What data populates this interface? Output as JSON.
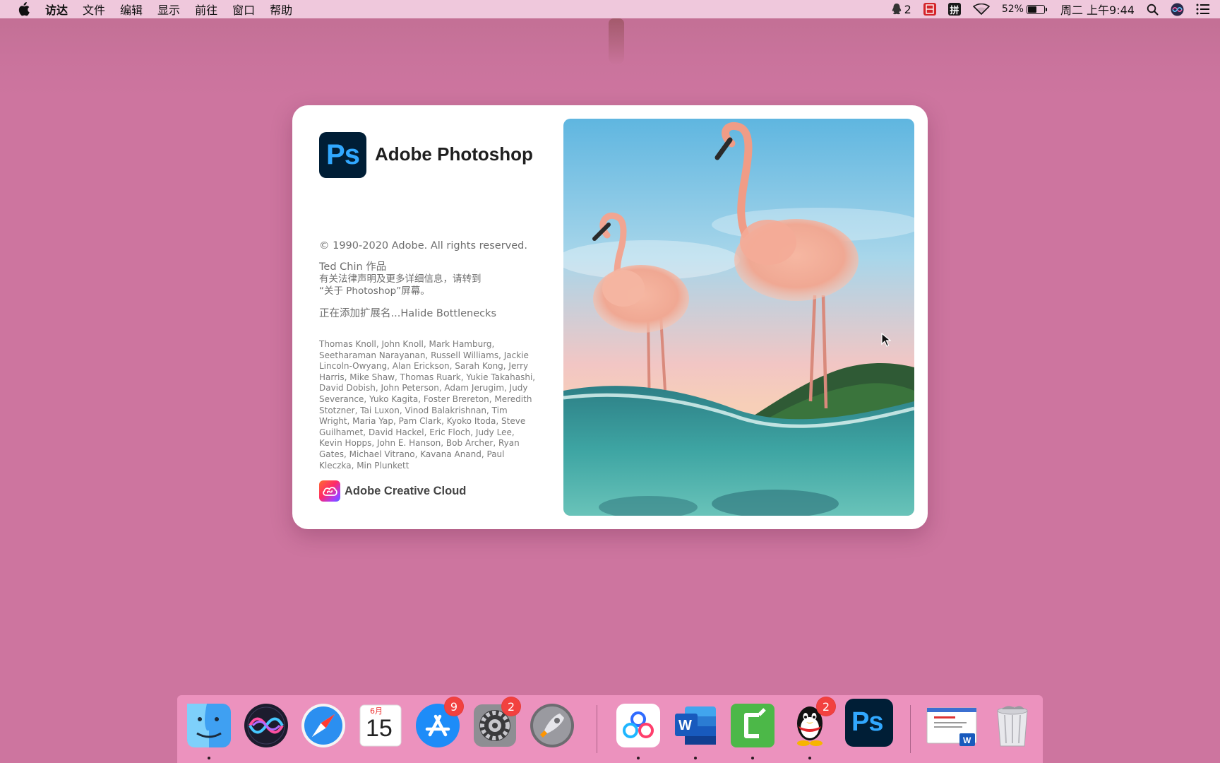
{
  "menubar": {
    "app_name": "访达",
    "items": [
      "文件",
      "编辑",
      "显示",
      "前往",
      "窗口",
      "帮助"
    ],
    "qq_count": "2",
    "input_method": "拼",
    "battery_percent": "52%",
    "battery_level": 0.52,
    "clock": "周二 上午9:44"
  },
  "splash": {
    "logo_text": "Ps",
    "app_name": "Adobe Photoshop",
    "copyright": "© 1990-2020 Adobe. All rights reserved.",
    "author": "Ted Chin 作品",
    "legal_line1": "有关法律声明及更多详细信息，请转到",
    "legal_line2": "“关于 Photoshop”屏幕。",
    "loading": "正在添加扩展名...Halide Bottlenecks",
    "credits": "Thomas Knoll, John Knoll, Mark Hamburg, Seetharaman Narayanan, Russell Williams, Jackie Lincoln-Owyang, Alan Erickson, Sarah Kong, Jerry Harris, Mike Shaw, Thomas Ruark, Yukie Takahashi, David Dobish, John Peterson, Adam Jerugim, Judy Severance, Yuko Kagita, Foster Brereton, Meredith Stotzner, Tai Luxon, Vinod Balakrishnan, Tim Wright, Maria Yap, Pam Clark, Kyoko Itoda, Steve Guilhamet, David Hackel, Eric Floch, Judy Lee, Kevin Hopps, John E. Hanson, Bob Archer, Ryan Gates, Michael Vitrano, Kavana Anand, Paul Kleczka, Min Plunkett",
    "cc_label": "Adobe Creative Cloud"
  },
  "dock": {
    "calendar_month": "6月",
    "calendar_day": "15",
    "appstore_badge": "9",
    "settings_badge": "2",
    "qq_badge": "2",
    "word_letter": "W",
    "ps_text": "Ps"
  },
  "colors": {
    "desktop": "#cd759f",
    "menubar": "#efc8dc",
    "ps_navy": "#001e36",
    "ps_blue": "#31a8ff",
    "dock": "#f096c3",
    "badge": "#f2413f"
  }
}
